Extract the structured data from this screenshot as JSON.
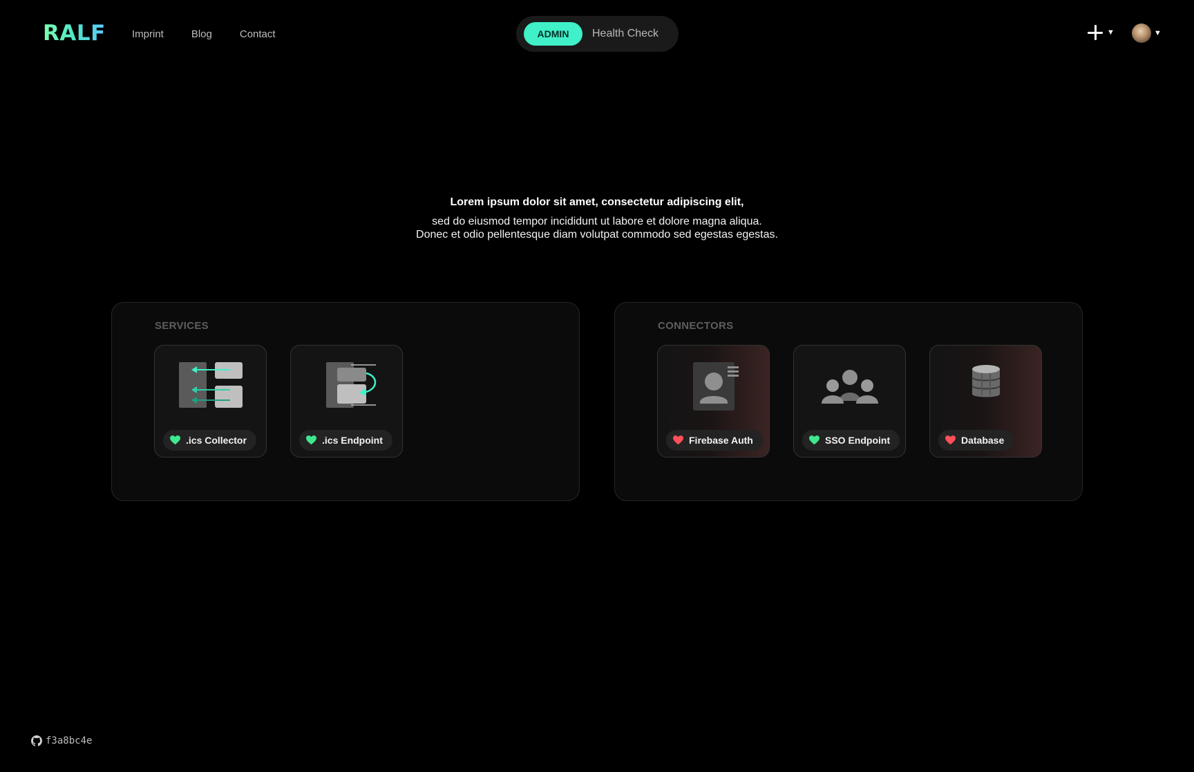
{
  "header": {
    "logo": "RALF",
    "nav": [
      {
        "label": "Imprint"
      },
      {
        "label": "Blog"
      },
      {
        "label": "Contact"
      }
    ],
    "mode_badge": "ADMIN",
    "health_check_label": "Health Check"
  },
  "intro": {
    "lead": "Lorem ipsum dolor sit amet, consectetur adipiscing elit,",
    "line1": "sed do eiusmod tempor incididunt ut labore et dolore magna aliqua.",
    "line2": "Donec et odio pellentesque diam volutpat commodo sed egestas egestas."
  },
  "services": {
    "title": "SERVICES",
    "items": [
      {
        "label": ".ics Collector",
        "status": "healthy",
        "icon": "ics-collector-icon"
      },
      {
        "label": ".ics Endpoint",
        "status": "healthy",
        "icon": "ics-endpoint-icon"
      }
    ]
  },
  "connectors": {
    "title": "CONNECTORS",
    "items": [
      {
        "label": "Firebase Auth",
        "status": "unhealthy",
        "icon": "contact-card-icon"
      },
      {
        "label": "SSO Endpoint",
        "status": "healthy",
        "icon": "users-group-icon"
      },
      {
        "label": "Database",
        "status": "unhealthy",
        "icon": "database-icon"
      }
    ]
  },
  "footer": {
    "commit": "f3a8bc4e"
  },
  "colors": {
    "accent": "#3ff0c8",
    "healthy": "#3fe88f",
    "unhealthy": "#ff4f5a",
    "background": "#000000",
    "panel": "#0b0b0b"
  }
}
